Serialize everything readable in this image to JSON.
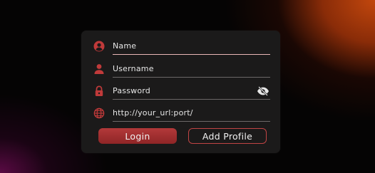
{
  "form": {
    "name_label": "Name",
    "username_label": "Username",
    "password_label": "Password",
    "url_placeholder": "http://your_url:port/"
  },
  "buttons": {
    "login": "Login",
    "add_profile": "Add Profile"
  },
  "colors": {
    "accent": "#c03a3a",
    "card_bg": "#1b1a1a",
    "glow_orange": "#c2470d",
    "glow_magenta": "#5a0a44"
  },
  "icons": {
    "name": "user-circle-icon",
    "username": "person-icon",
    "password": "lock-icon",
    "visibility": "eye-off-icon",
    "url": "globe-icon"
  }
}
